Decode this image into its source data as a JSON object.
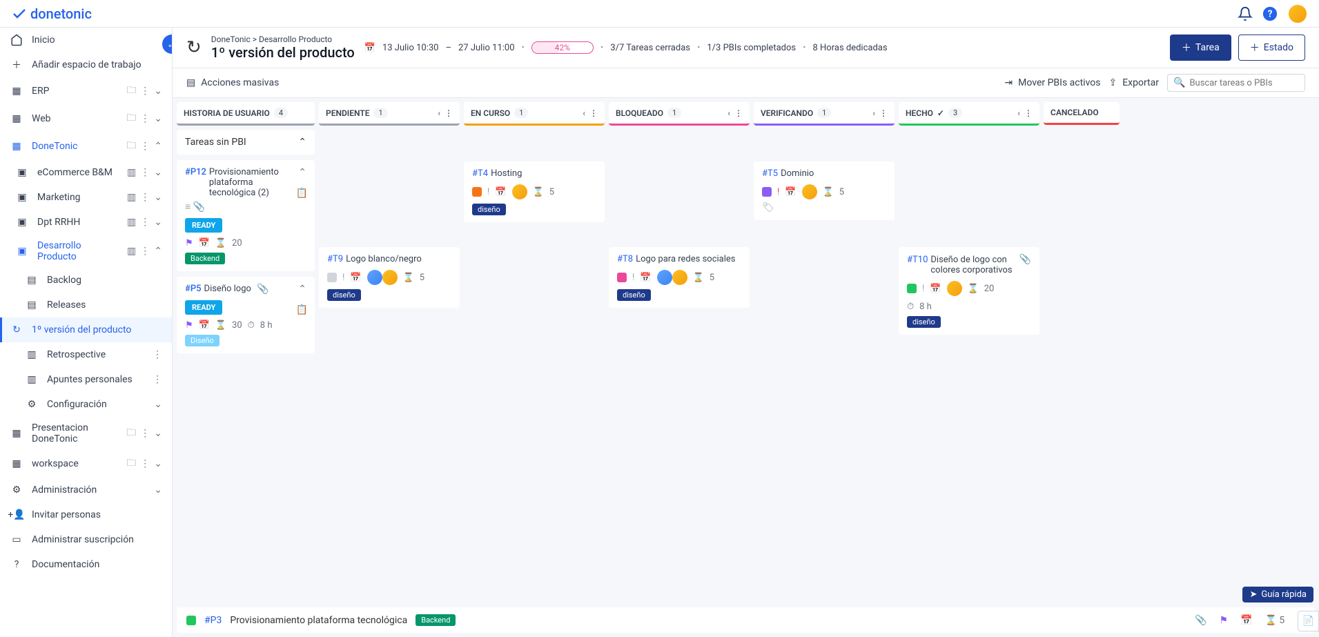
{
  "app": {
    "name": "donetonic"
  },
  "topbar": {
    "bell": "bell",
    "help": "help"
  },
  "sidebar": {
    "home": "Inicio",
    "add_workspace": "Añadir espacio de trabajo",
    "admin": "Administración",
    "invite": "Invitar personas",
    "subscription": "Administrar suscripción",
    "docs": "Documentación",
    "items": [
      {
        "label": "ERP"
      },
      {
        "label": "Web"
      },
      {
        "label": "DoneTonic",
        "active_ws": true,
        "children": [
          {
            "label": "eCommerce B&M"
          },
          {
            "label": "Marketing"
          },
          {
            "label": "Dpt RRHH"
          },
          {
            "label": "Desarrollo Producto",
            "active_proj": true,
            "children": [
              {
                "label": "Backlog"
              },
              {
                "label": "Releases"
              },
              {
                "label": "1º versión del producto",
                "active": true
              },
              {
                "label": "Retrospective"
              },
              {
                "label": "Apuntes personales"
              },
              {
                "label": "Configuración"
              }
            ]
          }
        ]
      },
      {
        "label": "Presentacion DoneTonic"
      },
      {
        "label": "workspace"
      }
    ]
  },
  "header": {
    "breadcrumb": "DoneTonic > Desarrollo Producto",
    "title": "1º versión del producto",
    "date_start": "13 Julio 10:30",
    "date_sep": "–",
    "date_end": "27 Julio 11:00",
    "progress": "42%",
    "stat1": "3/7 Tareas cerradas",
    "stat2": "1/3 PBIs completados",
    "stat3": "8 Horas dedicadas",
    "btn_task": "Tarea",
    "btn_state": "Estado"
  },
  "toolbar": {
    "bulk": "Acciones masivas",
    "move": "Mover PBIs activos",
    "export": "Exportar",
    "search_placeholder": "Buscar tareas o PBIs"
  },
  "columns": {
    "story": {
      "label": "HISTORIA DE USUARIO",
      "count": "4"
    },
    "pending": {
      "label": "PENDIENTE",
      "count": "1"
    },
    "progress": {
      "label": "EN CURSO",
      "count": "1"
    },
    "blocked": {
      "label": "BLOQUEADO",
      "count": "1"
    },
    "verifying": {
      "label": "VERIFICANDO",
      "count": "1"
    },
    "done": {
      "label": "HECHO",
      "count": "3"
    },
    "cancelled": {
      "label": "CANCELADO"
    }
  },
  "pbis": {
    "no_pbi": "Tareas sin PBI",
    "p12": {
      "id": "#P12",
      "title": "Provisionamiento plataforma tecnológica (2)",
      "status": "READY",
      "points": "20",
      "tag": "Backend"
    },
    "p5": {
      "id": "#P5",
      "title": "Diseño logo",
      "status": "READY",
      "points": "30",
      "hours": "8 h",
      "tag": "Diseño"
    },
    "p3": {
      "id": "#P3",
      "title": "Provisionamiento plataforma tecnológica",
      "tag": "Backend",
      "points": "5"
    }
  },
  "tasks": {
    "t4": {
      "id": "#T4",
      "title": "Hosting",
      "points": "5",
      "tag": "diseño"
    },
    "t5": {
      "id": "#T5",
      "title": "Dominio",
      "points": "5"
    },
    "t9": {
      "id": "#T9",
      "title": "Logo blanco/negro",
      "points": "5",
      "tag": "diseño"
    },
    "t8": {
      "id": "#T8",
      "title": "Logo para redes sociales",
      "points": "5",
      "tag": "diseño"
    },
    "t10": {
      "id": "#T10",
      "title": "Diseño de logo con colores corporativos",
      "points": "20",
      "hours": "8 h",
      "tag": "diseño"
    }
  },
  "footer": {
    "guide": "Guía rápida"
  }
}
